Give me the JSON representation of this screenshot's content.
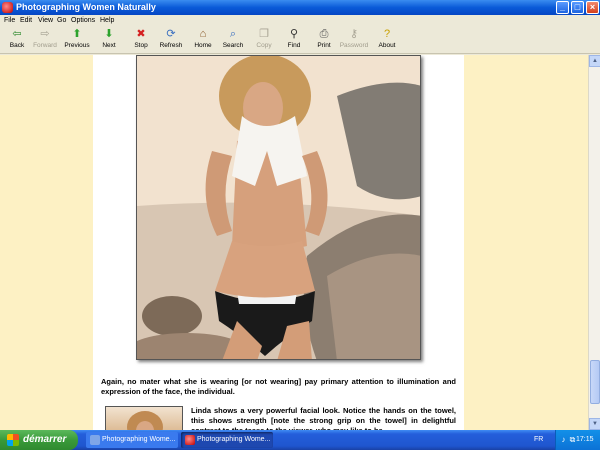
{
  "window": {
    "title": "Photographing Women Naturally"
  },
  "menu": [
    "File",
    "Edit",
    "View",
    "Go",
    "Options",
    "Help"
  ],
  "toolbar": [
    {
      "label": "Back",
      "icon": "arrow-left-icon",
      "glyph": "⇦",
      "enabled": true,
      "color": "#2d8a2d"
    },
    {
      "label": "Forward",
      "icon": "arrow-right-icon",
      "glyph": "⇨",
      "enabled": false,
      "color": "#a8a494"
    },
    {
      "label": "Previous",
      "icon": "arrow-up-icon",
      "glyph": "⬆",
      "enabled": true,
      "color": "#2da32d"
    },
    {
      "label": "Next",
      "icon": "arrow-down-icon",
      "glyph": "⬇",
      "enabled": true,
      "color": "#2da32d"
    },
    {
      "label": "Stop",
      "icon": "stop-icon",
      "glyph": "✖",
      "enabled": true,
      "color": "#d42020"
    },
    {
      "label": "Refresh",
      "icon": "refresh-icon",
      "glyph": "⟳",
      "enabled": true,
      "color": "#3a6fc0"
    },
    {
      "label": "Home",
      "icon": "home-icon",
      "glyph": "⌂",
      "enabled": true,
      "color": "#8a5a2a"
    },
    {
      "label": "Search",
      "icon": "search-icon",
      "glyph": "⌕",
      "enabled": true,
      "color": "#3a6fc0"
    },
    {
      "label": "Copy",
      "icon": "copy-icon",
      "glyph": "❐",
      "enabled": false,
      "color": "#a8a494"
    },
    {
      "label": "Find",
      "icon": "binoculars-icon",
      "glyph": "⚲",
      "enabled": true,
      "color": "#333333"
    },
    {
      "label": "Print",
      "icon": "print-icon",
      "glyph": "⎙",
      "enabled": true,
      "color": "#555555"
    },
    {
      "label": "Password",
      "icon": "key-icon",
      "glyph": "⚷",
      "enabled": false,
      "color": "#a8a494"
    },
    {
      "label": "About",
      "icon": "question-icon",
      "glyph": "?",
      "enabled": true,
      "color": "#c8a000"
    }
  ],
  "content": {
    "paragraph1": "Again, no mater what she is wearing [or not wearing] pay primary attention to illumination and expression of the face, the individual.",
    "paragraph2": "Linda shows a very powerful facial look. Notice the hands on the towel, this shows strength [note the strong grip on the towel] in delightful contrast to the tease to the viewer, who may like to be"
  },
  "taskbar": {
    "start_label": "démarrer",
    "tasks": [
      {
        "label": "Photographing Wome...",
        "active": false
      },
      {
        "label": "Photographing Wome...",
        "active": true
      }
    ],
    "language": "FR",
    "clock": "17:15"
  },
  "colors": {
    "page_background": "#fdf1c4",
    "titlebar": "#0a5ad8",
    "taskbar": "#245edb"
  }
}
